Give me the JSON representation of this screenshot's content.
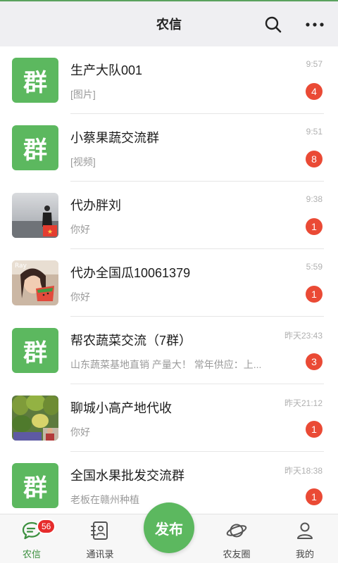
{
  "header": {
    "title": "农信",
    "search_icon": "search-icon",
    "more_icon": "more-dots-icon"
  },
  "chats": [
    {
      "name": "生产大队001",
      "preview": "[图片]",
      "time": "9:57",
      "badge": "4",
      "avatar_text": "群"
    },
    {
      "name": "小蔡果蔬交流群",
      "preview": "[视频]",
      "time": "9:51",
      "badge": "8",
      "avatar_text": "群"
    },
    {
      "name": "代办胖刘",
      "preview": "你好",
      "time": "9:38",
      "badge": "1",
      "avatar_text": ""
    },
    {
      "name": "代办全国瓜10061379",
      "preview": "你好",
      "time": "5:59",
      "badge": "1",
      "avatar_text": "",
      "avatar_overlay": "Ray"
    },
    {
      "name": "帮农蔬菜交流（7群）",
      "preview": "山东蔬菜基地直销 产量大！ 常年供应：上...",
      "time": "昨天23:43",
      "badge": "3",
      "avatar_text": "群"
    },
    {
      "name": "聊城小高产地代收",
      "preview": "你好",
      "time": "昨天21:12",
      "badge": "1",
      "avatar_text": ""
    },
    {
      "name": "全国水果批发交流群",
      "preview": "老板在赣州种植",
      "time": "昨天18:38",
      "badge": "1",
      "avatar_text": "群"
    }
  ],
  "tabbar": {
    "tabs": [
      {
        "label": "农信",
        "icon": "chat-icon",
        "badge": "56"
      },
      {
        "label": "通讯录",
        "icon": "contacts-icon"
      },
      {
        "label": "农友圈",
        "icon": "planet-icon"
      },
      {
        "label": "我的",
        "icon": "profile-icon"
      }
    ],
    "publish_label": "发布"
  },
  "colors": {
    "brand_green": "#5cb85f",
    "badge_red": "#ea4a35",
    "active_tab": "#3b8f3e"
  }
}
